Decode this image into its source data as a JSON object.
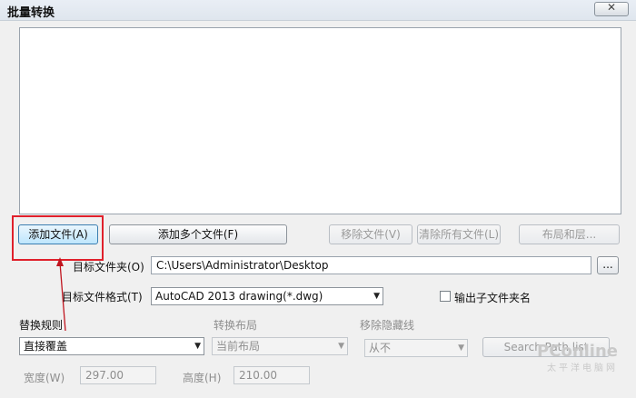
{
  "window": {
    "title": "批量转换"
  },
  "buttons": {
    "add_file": "添加文件(A)",
    "add_multiple": "添加多个文件(F)",
    "remove_file": "移除文件(V)",
    "clear_all": "清除所有文件(L)",
    "layout_layers": "布局和层...",
    "browse": "...",
    "search_path": "Search Path list"
  },
  "target_folder": {
    "label": "目标文件夹(O)",
    "value": "C:\\Users\\Administrator\\Desktop"
  },
  "target_format": {
    "label": "目标文件格式(T)",
    "value": "AutoCAD 2013 drawing(*.dwg)"
  },
  "output_subfolder": {
    "label": "输出子文件夹名",
    "checked": false
  },
  "replace_rule": {
    "label": "替换规则",
    "value": "直接覆盖"
  },
  "convert_layout": {
    "label": "转换布局",
    "value": "当前布局"
  },
  "remove_hidden": {
    "label": "移除隐藏线",
    "value": "从不"
  },
  "width": {
    "label": "宽度(W)",
    "value": "297.00"
  },
  "height": {
    "label": "高度(H)",
    "value": "210.00"
  },
  "watermark": {
    "brand": "PConline",
    "sub": "太平洋电脑网"
  },
  "colors": {
    "highlight": "#e0202b",
    "arrow": "#c0141e"
  }
}
